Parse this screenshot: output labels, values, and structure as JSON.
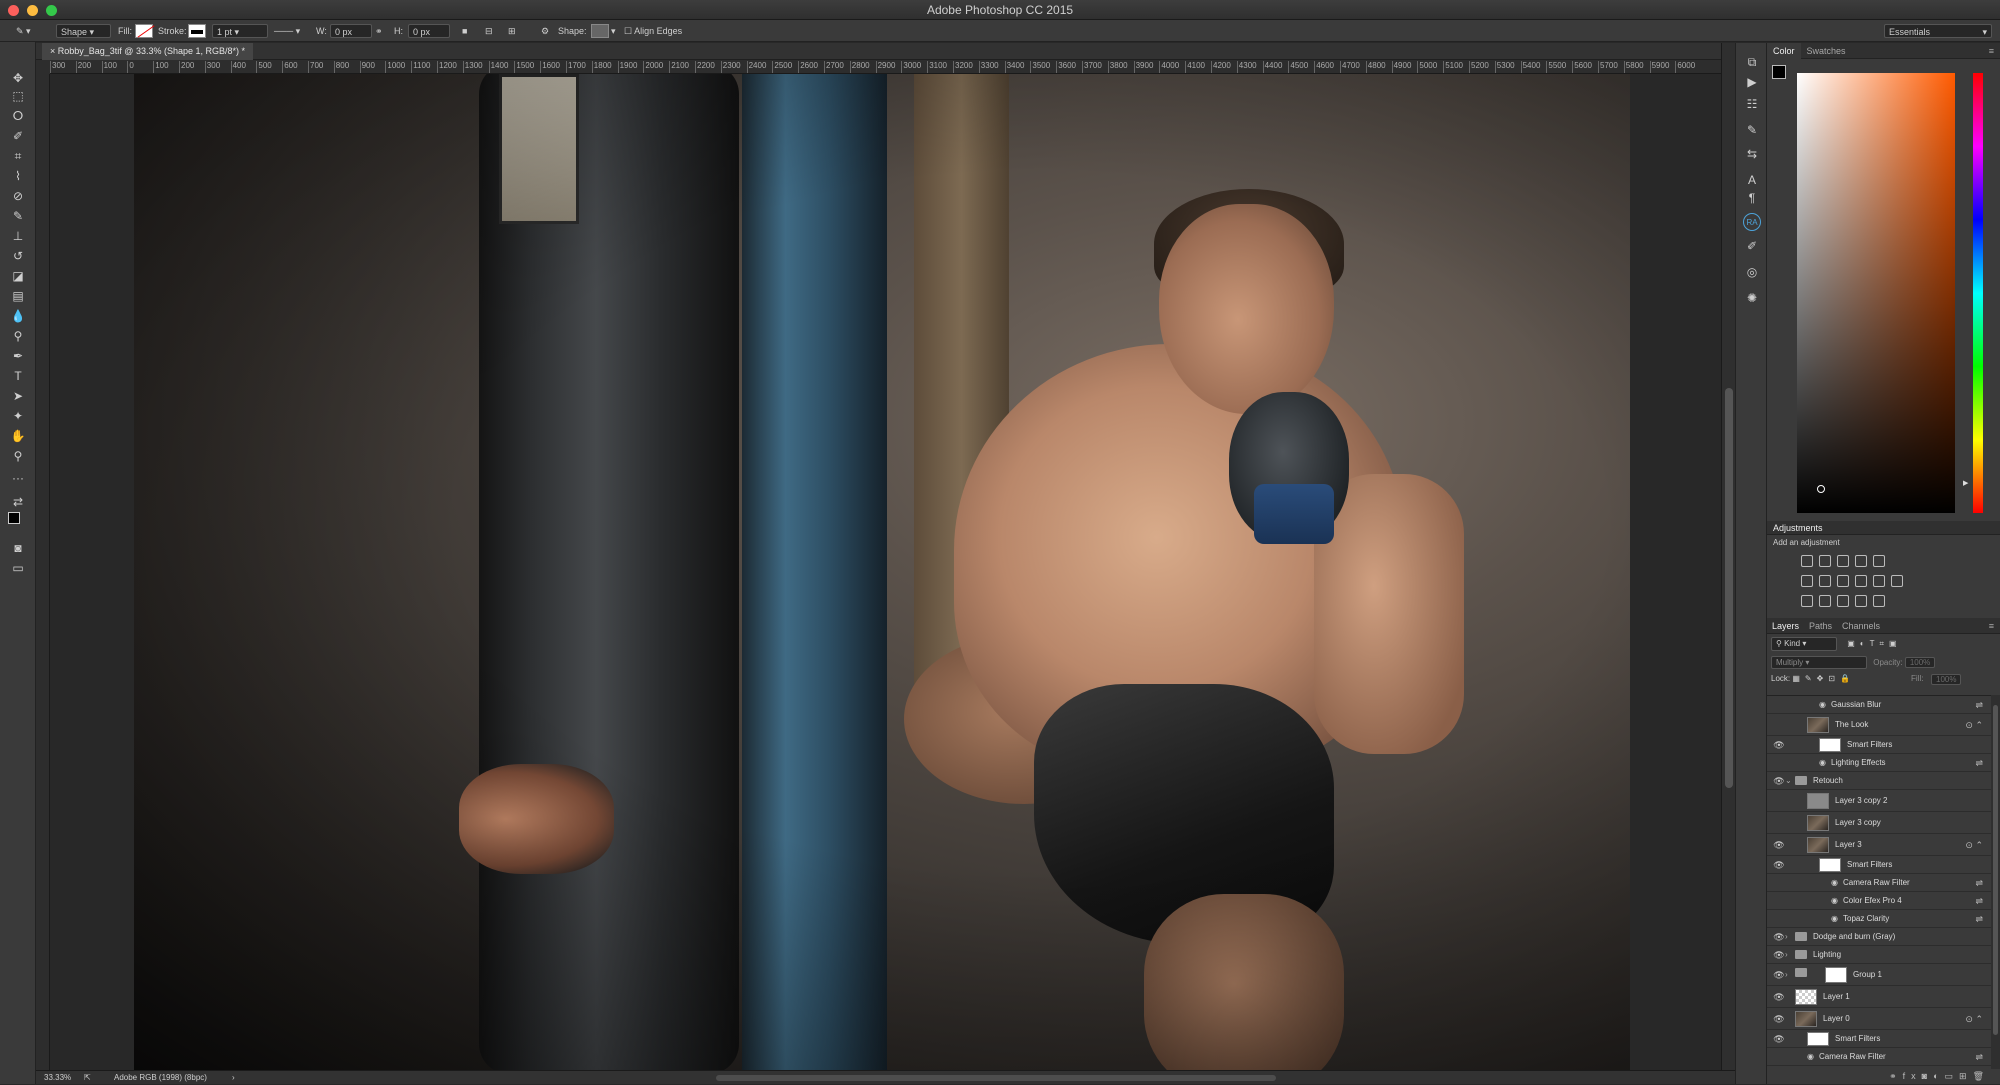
{
  "app": {
    "window_title": "Adobe Photoshop CC 2015",
    "workspace": "Essentials"
  },
  "options": {
    "tool_mode": "Shape",
    "fill_label": "Fill:",
    "stroke_label": "Stroke:",
    "stroke_width": "1 pt",
    "w_label": "W:",
    "w_value": "0 px",
    "h_label": "H:",
    "h_value": "0 px",
    "shape_label": "Shape:",
    "align_edges": "Align Edges"
  },
  "document": {
    "tab_title": "Robby_Bag_3tif @ 33.3% (Shape 1, RGB/8*) *",
    "zoom": "33.33%",
    "profile": "Adobe RGB (1998) (8bpc)"
  },
  "ruler": {
    "h_ticks": [
      "300",
      "200",
      "100",
      "0",
      "100",
      "200",
      "300",
      "400",
      "500",
      "600",
      "700",
      "800",
      "900",
      "1000",
      "1100",
      "1200",
      "1300",
      "1400",
      "1500",
      "1600",
      "1700",
      "1800",
      "1900",
      "2000",
      "2100",
      "2200",
      "2300",
      "2400",
      "2500",
      "2600",
      "2700",
      "2800",
      "2900",
      "3000",
      "3100",
      "3200",
      "3300",
      "3400",
      "3500",
      "3600",
      "3700",
      "3800",
      "3900",
      "4000",
      "4100",
      "4200",
      "4300",
      "4400",
      "4500",
      "4600",
      "4700",
      "4800",
      "4900",
      "5000",
      "5100",
      "5200",
      "5300",
      "5400",
      "5500",
      "5600",
      "5700",
      "5800",
      "5900",
      "6000"
    ]
  },
  "color_panel": {
    "tabs": [
      "Color",
      "Swatches"
    ]
  },
  "adjustments": {
    "title": "Adjustments",
    "subtitle": "Add an adjustment"
  },
  "layers_panel": {
    "tabs": [
      "Layers",
      "Paths",
      "Channels"
    ],
    "filter_kind": "Kind",
    "blend_mode": "Multiply",
    "opacity_label": "Opacity:",
    "opacity_value": "100%",
    "lock_label": "Lock:",
    "fill_label": "Fill:",
    "fill_value": "100%",
    "layers": [
      {
        "name": "Gaussian Blur",
        "type": "filter",
        "indent": 2,
        "visible": false
      },
      {
        "name": "The Look",
        "type": "smart",
        "indent": 1,
        "visible": false,
        "thumb": "dark"
      },
      {
        "name": "Smart Filters",
        "type": "mask",
        "indent": 2,
        "visible": true
      },
      {
        "name": "Lighting Effects",
        "type": "filter",
        "indent": 2,
        "visible": false
      },
      {
        "name": "Retouch",
        "type": "group",
        "indent": 0,
        "visible": true
      },
      {
        "name": "Layer 3 copy 2",
        "type": "layer",
        "indent": 1,
        "visible": false,
        "thumb": "gray"
      },
      {
        "name": "Layer 3 copy",
        "type": "layer",
        "indent": 1,
        "visible": false,
        "thumb": "dark"
      },
      {
        "name": "Layer 3",
        "type": "smart",
        "indent": 1,
        "visible": true,
        "thumb": "dark"
      },
      {
        "name": "Smart Filters",
        "type": "mask",
        "indent": 2,
        "visible": true
      },
      {
        "name": "Camera Raw Filter",
        "type": "filter",
        "indent": 3,
        "visible": false
      },
      {
        "name": "Color Efex Pro 4",
        "type": "filter",
        "indent": 3,
        "visible": false
      },
      {
        "name": "Topaz Clarity",
        "type": "filter",
        "indent": 3,
        "visible": false
      },
      {
        "name": "Dodge and burn (Gray)",
        "type": "group",
        "indent": 0,
        "visible": true
      },
      {
        "name": "Lighting",
        "type": "group",
        "indent": 0,
        "visible": true
      },
      {
        "name": "Group 1",
        "type": "groupmask",
        "indent": 0,
        "visible": true
      },
      {
        "name": "Layer 1",
        "type": "layer",
        "indent": 0,
        "visible": true,
        "thumb": "check"
      },
      {
        "name": "Layer 0",
        "type": "smart",
        "indent": 0,
        "visible": true,
        "thumb": "dark"
      },
      {
        "name": "Smart Filters",
        "type": "mask",
        "indent": 1,
        "visible": true
      },
      {
        "name": "Camera Raw Filter",
        "type": "filter",
        "indent": 1,
        "visible": false
      }
    ]
  },
  "tools": [
    "move-tool",
    "marquee-tool",
    "lasso-tool",
    "quick-select-tool",
    "crop-tool",
    "eyedropper-tool",
    "spot-heal-tool",
    "brush-tool",
    "clone-stamp-tool",
    "history-brush-tool",
    "eraser-tool",
    "gradient-tool",
    "blur-tool",
    "dodge-tool",
    "pen-tool",
    "type-tool",
    "path-select-tool",
    "shape-tool",
    "hand-tool",
    "zoom-tool",
    "more-tools"
  ],
  "colors": {
    "accent": "#1473e6",
    "panel": "#3a3a3a",
    "dark": "#282828"
  }
}
